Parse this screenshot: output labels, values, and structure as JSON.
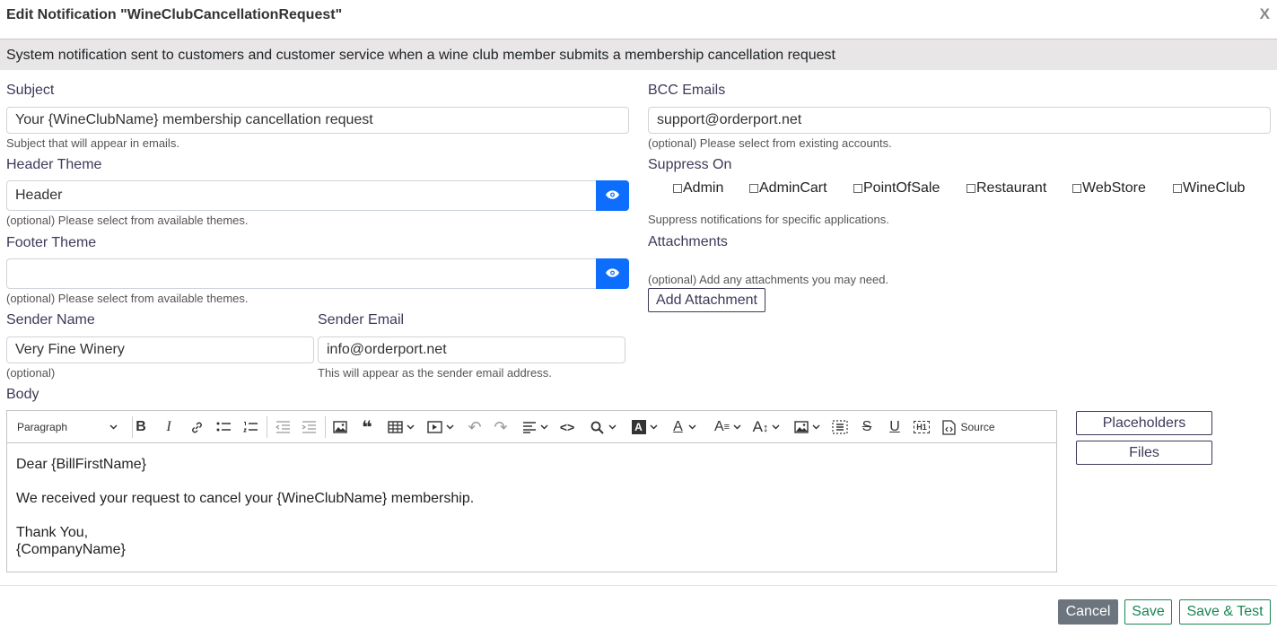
{
  "dialog": {
    "title": "Edit Notification \"WineClubCancellationRequest\"",
    "close_label": "X",
    "description": "System notification sent to customers and customer service when a wine club member submits a membership cancellation request"
  },
  "subject": {
    "label": "Subject",
    "value": "Your {WineClubName} membership cancellation request",
    "hint": "Subject that will appear in emails."
  },
  "header_theme": {
    "label": "Header Theme",
    "value": "Header",
    "hint": "(optional) Please select from available themes."
  },
  "footer_theme": {
    "label": "Footer Theme",
    "value": "",
    "hint": "(optional) Please select from available themes."
  },
  "sender_name": {
    "label": "Sender Name",
    "value": "Very Fine Winery",
    "hint": "(optional)"
  },
  "sender_email": {
    "label": "Sender Email",
    "value": "info@orderport.net",
    "hint": "This will appear as the sender email address."
  },
  "bcc": {
    "label": "BCC Emails",
    "value": "support@orderport.net",
    "hint": "(optional) Please select from existing accounts."
  },
  "suppress": {
    "label": "Suppress On",
    "options": [
      "Admin",
      "AdminCart",
      "PointOfSale",
      "Restaurant",
      "WebStore",
      "WineClub"
    ],
    "checked": [
      false,
      false,
      false,
      false,
      false,
      false
    ],
    "hint": "Suppress notifications for specific applications."
  },
  "attachments": {
    "label": "Attachments",
    "hint": "(optional) Add any attachments you may need.",
    "add_button": "Add Attachment"
  },
  "body": {
    "label": "Body",
    "format_select": "Paragraph",
    "source_label": "Source",
    "lines": [
      "Dear {BillFirstName}",
      "We received your request to cancel your {WineClubName} membership.",
      "Thank You,",
      "{CompanyName}"
    ]
  },
  "side_buttons": {
    "placeholders": "Placeholders",
    "files": "Files"
  },
  "footer": {
    "cancel": "Cancel",
    "save": "Save",
    "save_test": "Save & Test"
  },
  "colors": {
    "primary": "#0d6efd",
    "label": "#3d3a59",
    "save_green": "#198754",
    "cancel_gray": "#6c757d"
  }
}
